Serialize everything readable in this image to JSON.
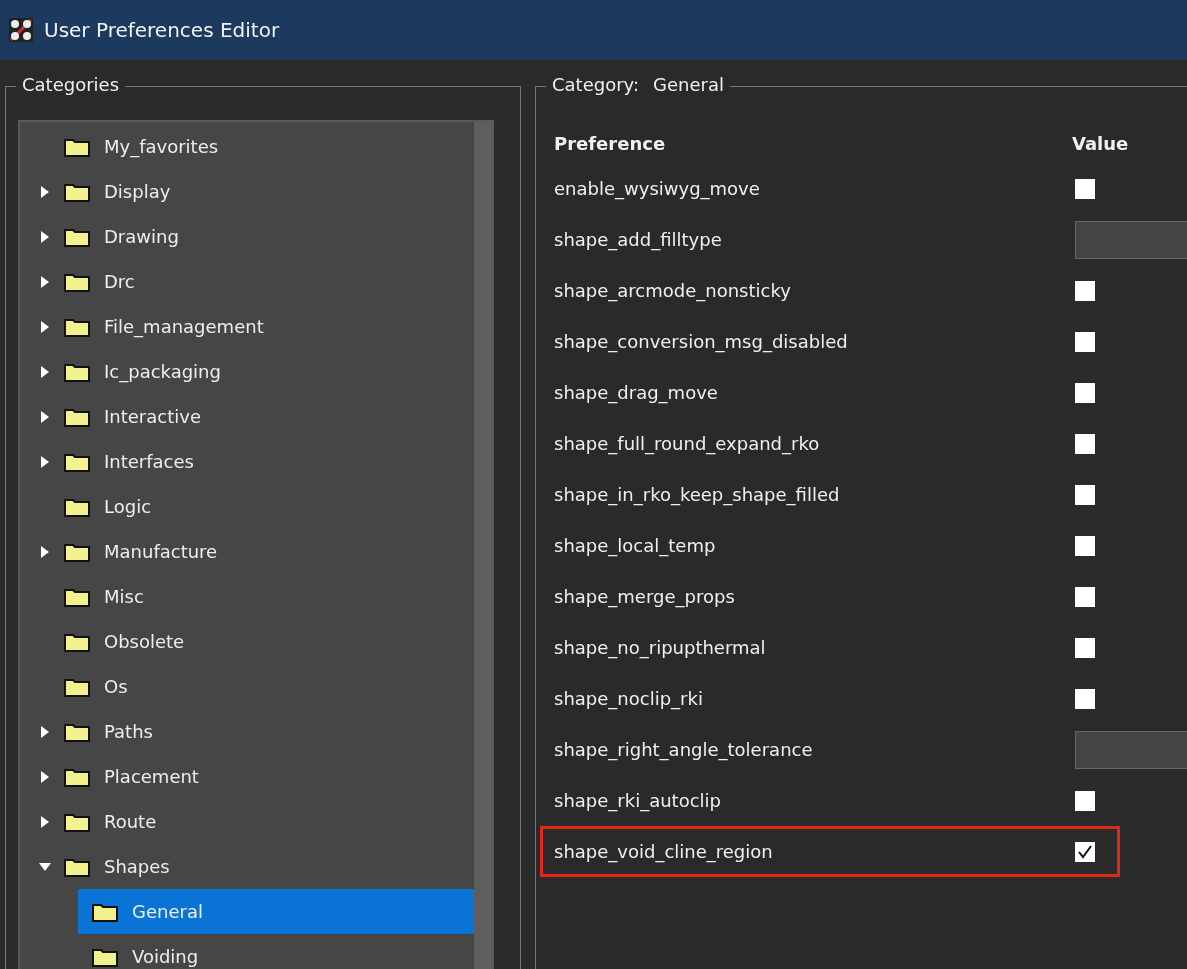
{
  "window": {
    "title": "User Preferences Editor"
  },
  "categories": {
    "title": "Categories",
    "tree": [
      {
        "label": "My_favorites",
        "selected": false
      },
      {
        "label": "Display",
        "expanded": false,
        "selected": false
      },
      {
        "label": "Drawing",
        "expanded": false,
        "selected": false
      },
      {
        "label": "Drc",
        "expanded": false,
        "selected": false
      },
      {
        "label": "File_management",
        "expanded": false,
        "selected": false
      },
      {
        "label": "Ic_packaging",
        "expanded": false,
        "selected": false
      },
      {
        "label": "Interactive",
        "expanded": false,
        "selected": false
      },
      {
        "label": "Interfaces",
        "expanded": false,
        "selected": false
      },
      {
        "label": "Logic",
        "selected": false
      },
      {
        "label": "Manufacture",
        "expanded": false,
        "selected": false
      },
      {
        "label": "Misc",
        "selected": false
      },
      {
        "label": "Obsolete",
        "selected": false
      },
      {
        "label": "Os",
        "selected": false
      },
      {
        "label": "Paths",
        "expanded": false,
        "selected": false
      },
      {
        "label": "Placement",
        "expanded": false,
        "selected": false
      },
      {
        "label": "Route",
        "expanded": false,
        "selected": false
      },
      {
        "label": "Shapes",
        "expanded": true,
        "selected": false,
        "children": [
          {
            "label": "General",
            "selected": true
          },
          {
            "label": "Voiding",
            "selected": false
          }
        ]
      }
    ]
  },
  "category": {
    "label": "Category:",
    "name": "General",
    "columns": [
      "Preference",
      "Value"
    ],
    "rows": [
      {
        "name": "enable_wysiwyg_move",
        "kind": "checkbox",
        "checked": false,
        "highlighted": false
      },
      {
        "name": "shape_add_filltype",
        "kind": "text",
        "highlighted": false
      },
      {
        "name": "shape_arcmode_nonsticky",
        "kind": "checkbox",
        "checked": false,
        "highlighted": false
      },
      {
        "name": "shape_conversion_msg_disabled",
        "kind": "checkbox",
        "checked": false,
        "highlighted": false
      },
      {
        "name": "shape_drag_move",
        "kind": "checkbox",
        "checked": false,
        "highlighted": false
      },
      {
        "name": "shape_full_round_expand_rko",
        "kind": "checkbox",
        "checked": false,
        "highlighted": false
      },
      {
        "name": "shape_in_rko_keep_shape_filled",
        "kind": "checkbox",
        "checked": false,
        "highlighted": false
      },
      {
        "name": "shape_local_temp",
        "kind": "checkbox",
        "checked": false,
        "highlighted": false
      },
      {
        "name": "shape_merge_props",
        "kind": "checkbox",
        "checked": false,
        "highlighted": false
      },
      {
        "name": "shape_no_ripupthermal",
        "kind": "checkbox",
        "checked": false,
        "highlighted": false
      },
      {
        "name": "shape_noclip_rki",
        "kind": "checkbox",
        "checked": false,
        "highlighted": false
      },
      {
        "name": "shape_right_angle_tolerance",
        "kind": "text",
        "highlighted": false
      },
      {
        "name": "shape_rki_autoclip",
        "kind": "checkbox",
        "checked": false,
        "highlighted": false
      },
      {
        "name": "shape_void_cline_region",
        "kind": "checkbox",
        "checked": true,
        "highlighted": true
      }
    ]
  }
}
